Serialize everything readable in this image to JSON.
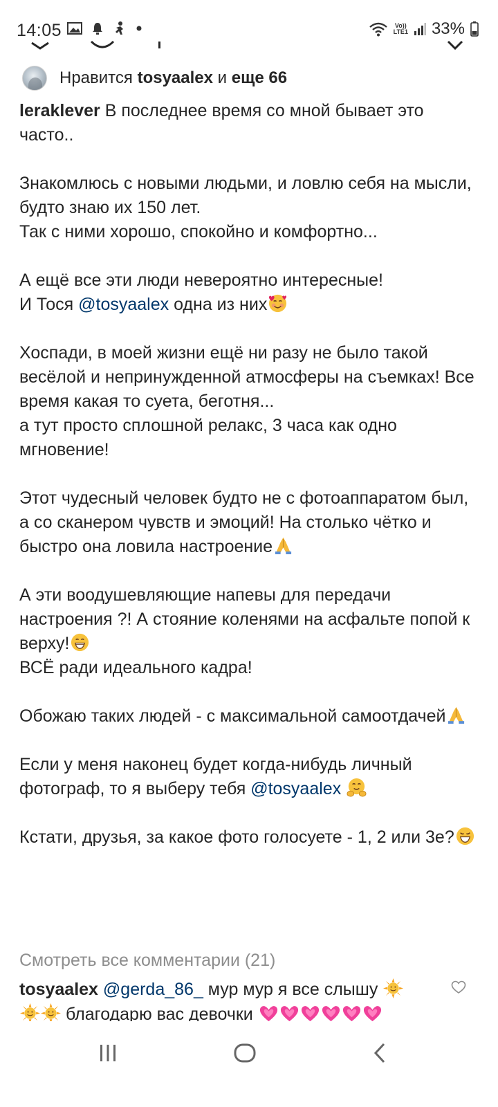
{
  "status_bar": {
    "time": "14:05",
    "battery_percent": "33%",
    "network_label": "LTE1",
    "volte_label": "Vo))",
    "icons": [
      "gallery-icon",
      "notification-icon",
      "figure-icon",
      "dot-icon",
      "wifi-icon",
      "signal-icon",
      "battery-icon"
    ]
  },
  "likes": {
    "prefix": "Нравится ",
    "user": "tosyaalex",
    "conjunction": " и ",
    "others": "еще 66"
  },
  "caption": {
    "author": "leraklever",
    "p1": "В последнее время со мной бывает это часто..",
    "p2a": "Знакомлюсь с новыми людьми, и ловлю себя на мысли, будто знаю их 150 лет.",
    "p2b": "Так с ними хорошо, спокойно и комфортно...",
    "p3a": "А ещё все эти люди невероятно  интересные!",
    "p3b_before": "И Тося ",
    "p3b_mention": "@tosyaalex",
    "p3b_after": " одна из них",
    "p4a": "Хоспади, в  моей жизни ещё ни разу не было такой весёлой и непринужденной атмосферы на съемках! Все время какая то суета, беготня...",
    "p4b": "а тут просто сплошной релакс, 3 часа как одно мгновение!",
    "p5": "Этот  чудесный человек будто не с фотоаппаратом был, а со сканером чувств и эмоций! На столько чётко и быстро она ловила настроение",
    "p6a": "А эти воодушевляющие напевы для передачи настроения ?! А стояние коленями на асфальте попой к верху!",
    "p6b": "ВСЁ ради идеального кадра!",
    "p7": "Обожаю таких людей - с максимальной самоотдачей",
    "p8_before": "Если у меня наконец будет когда-нибудь личный фотограф, то я выберу тебя ",
    "p8_mention": "@tosyaalex",
    "p9": "Кстати, друзья, за какое фото голосуете - 1, 2 или 3е?"
  },
  "view_all_comments": "Смотреть все комментарии (21)",
  "comment": {
    "author": "tosyaalex",
    "mention": "@gerda_86_",
    "text1": " мур мур я все слышу ",
    "text2": " благодарю вас девочки "
  },
  "nav": {
    "icons": [
      "recent-apps-icon",
      "home-icon",
      "back-icon"
    ]
  },
  "colors": {
    "text": "#262626",
    "mention": "#00376b",
    "secondary": "#8e8e8e"
  }
}
